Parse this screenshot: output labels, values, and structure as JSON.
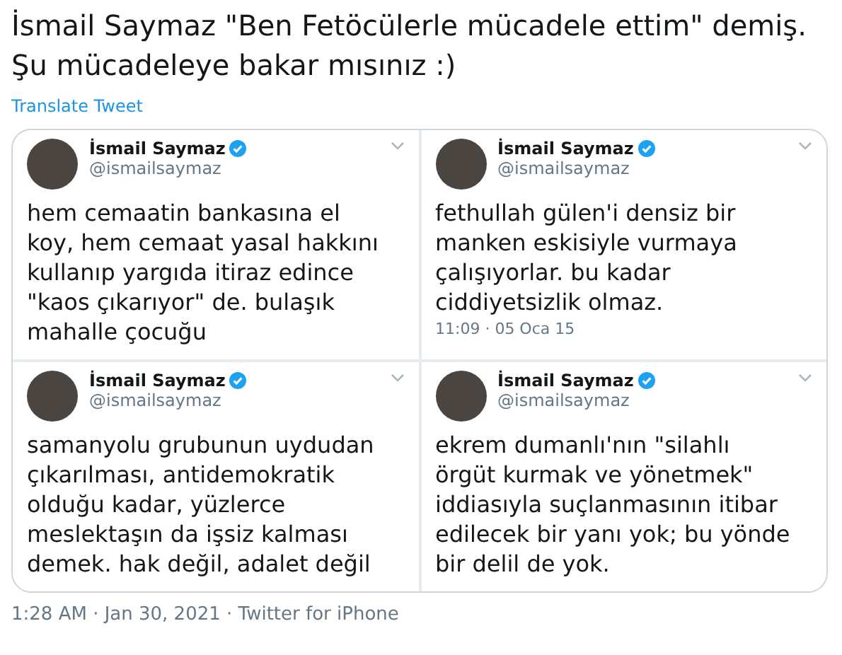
{
  "tweet": {
    "text": "İsmail Saymaz \"Ben Fetöcülerle mücadele ettim\" demiş. Şu mücadeleye bakar mısınız :)",
    "translate_link": "Translate Tweet",
    "media": [
      {
        "name": "İsmail Saymaz",
        "verified": true,
        "handle": "@ismailsaymaz",
        "text": "hem cemaatin bankasına el koy, hem cemaat yasal hakkını kullanıp yargıda itiraz edince \"kaos çıkarıyor\" de. bulaşık mahalle çocuğu"
      },
      {
        "name": "İsmail Saymaz",
        "verified": true,
        "handle": "@ismailsaymaz",
        "text": "fethullah gülen'i densiz bir manken eskisiyle vurmaya çalışıyorlar. bu kadar ciddiyetsizlik olmaz.",
        "timestamp": "11:09 · 05 Oca 15"
      },
      {
        "name": "İsmail Saymaz",
        "verified": true,
        "handle": "@ismailsaymaz",
        "text": "samanyolu grubunun uydudan çıkarılması, antidemokratik olduğu kadar, yüzlerce meslektaşın da işsiz kalması demek. hak değil, adalet değil"
      },
      {
        "name": "İsmail Saymaz",
        "verified": true,
        "handle": "@ismailsaymaz",
        "text": "ekrem dumanlı'nın \"silahlı örgüt kurmak ve yönetmek\" iddiasıyla suçlanmasının itibar edilecek bir yanı yok; bu yönde bir delil de yok."
      }
    ],
    "meta": "1:28 AM · Jan 30, 2021 · Twitter for iPhone"
  }
}
